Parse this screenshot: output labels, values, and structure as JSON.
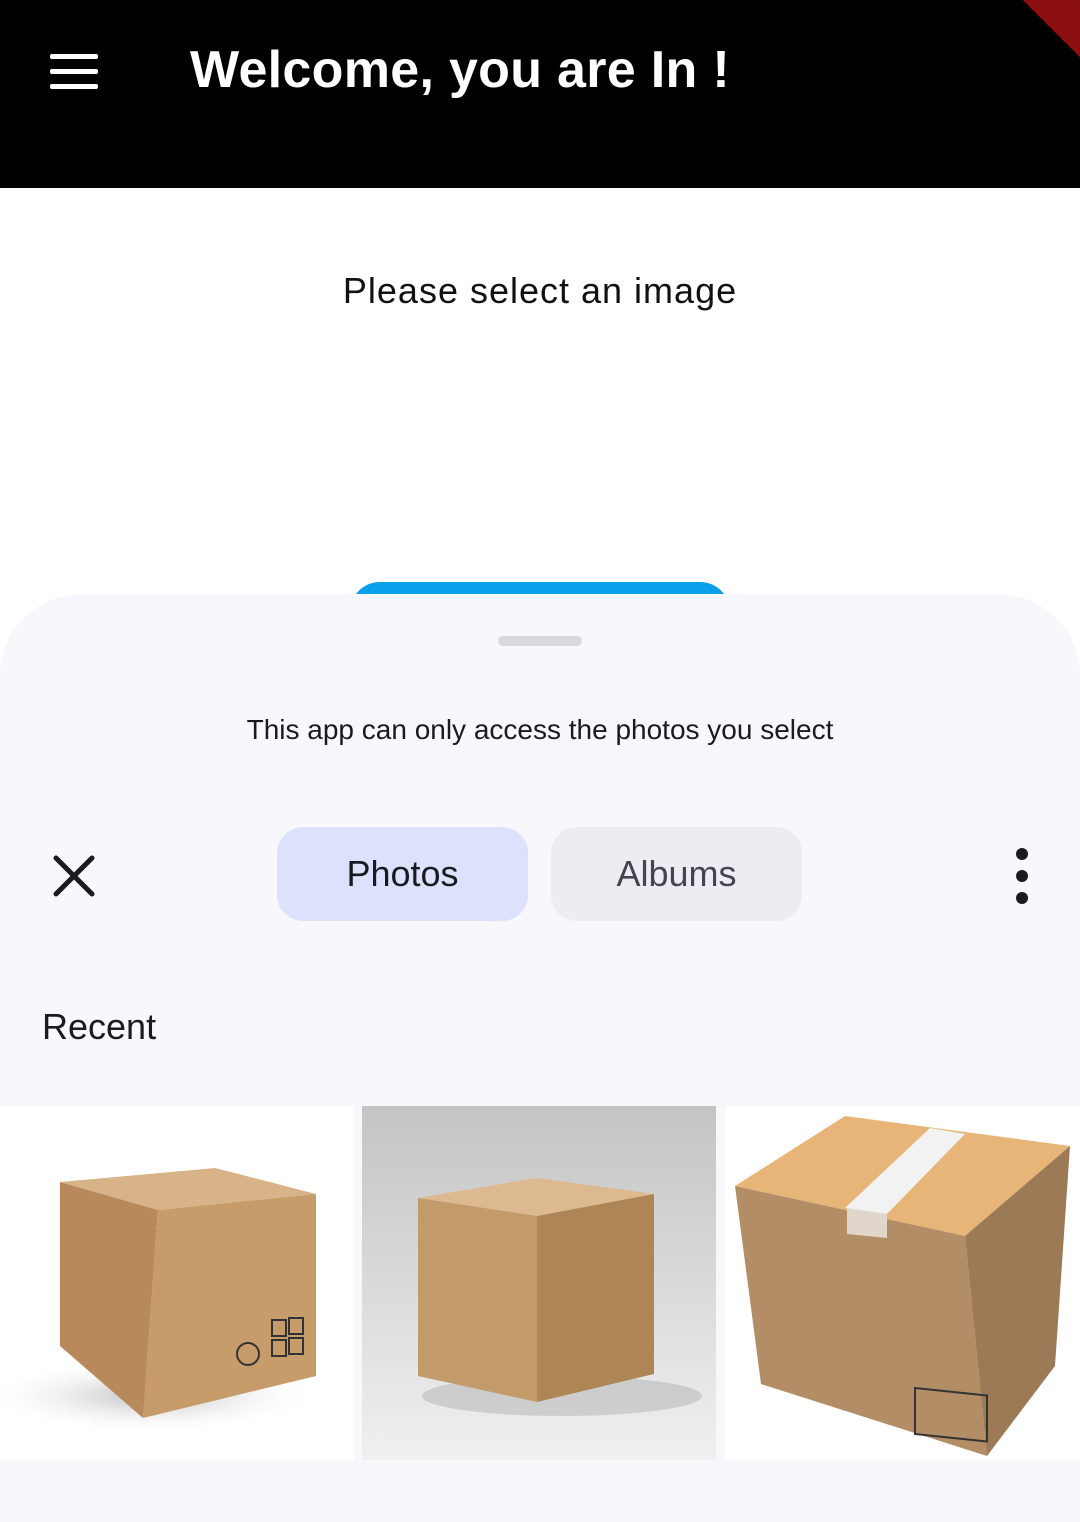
{
  "app_bar": {
    "title": "Welcome, you are In !",
    "menu_icon": "hamburger-menu-icon"
  },
  "page": {
    "message": "Please select an image"
  },
  "photo_picker": {
    "access_notice": "This app can only access the photos you select",
    "close_icon": "close-icon",
    "more_icon": "more-vertical-icon",
    "tabs": [
      {
        "label": "Photos",
        "selected": true
      },
      {
        "label": "Albums",
        "selected": false
      }
    ],
    "section_title": "Recent",
    "thumbnails": [
      "cardboard-box-photo-1",
      "cardboard-box-photo-2",
      "cardboard-box-photo-3"
    ]
  },
  "colors": {
    "app_bar_bg": "#000000",
    "button_blue": "#0aa0ea",
    "sheet_bg": "#f7f7fc",
    "tab_selected_bg": "#dce2fc",
    "tab_unselected_bg": "#ececf2"
  }
}
